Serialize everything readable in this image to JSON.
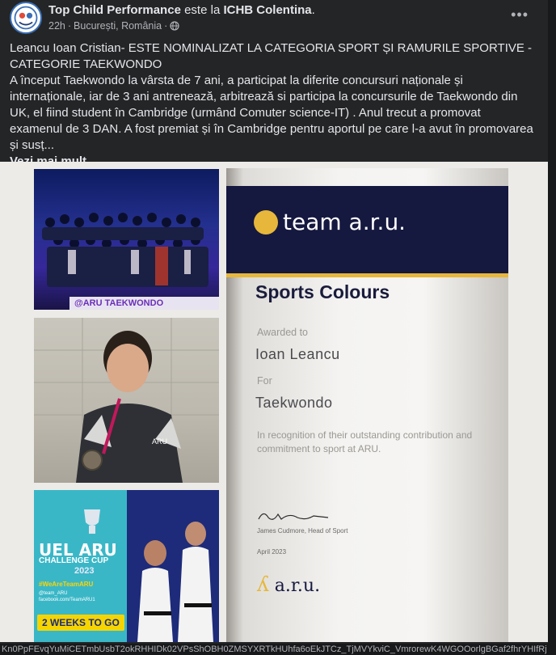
{
  "header": {
    "page_name": "Top Child Performance",
    "connector": " este la ",
    "place": "ICHB Colentina",
    "dot": ".",
    "time": "22h",
    "location": "București, România"
  },
  "post": {
    "paragraph1": "Leancu Ioan Cristian- ESTE NOMINALIZAT LA CATEGORIA SPORT ȘI RAMURILE SPORTIVE - CATEGORIE TAEKWONDO",
    "paragraph2": " A început Taekwondo la vârsta de 7 ani, a participat la diferite concursuri naționale și internaționale, iar de 3 ani antrenează, arbitrează si participa la concursurile de Taekwondo din UK, el fiind student în Cambridge (urmând Comuter science-IT) . Anul trecut a promovat examenul de 3 DAN. A fost premiat și în Cambridge pentru aportul pe care l-a avut în promovarea și susț...",
    "see_more": "Vezi mai mult"
  },
  "photos": {
    "crowd_handle": "@ARU TAEKWONDO",
    "uel_logo": "UEL ARU",
    "challenge_cup": "CHALLENGE CUP",
    "year": "2023",
    "hashtag": "#WeAreTeamARU",
    "social_1": "@team_ARU",
    "social_2": "facebook.com/TeamARU1",
    "countdown": "2 WEEKS TO GO"
  },
  "certificate": {
    "brand": "team a.r.u.",
    "title": "Sports Colours",
    "awarded_label": "Awarded to",
    "awarded_name": "Ioan Leancu",
    "for_label": "For",
    "for_value": "Taekwondo",
    "recognition": "In recognition of their outstanding contribution and commitment to sport at ARU.",
    "signer": "James Cudmore, Head of Sport",
    "date": "April 2023",
    "footer_logo": "a.r.u."
  },
  "urlbar": "Kn0PpFEvqYuMiCETmbUsbT2okRHHIDk02VPsShOBH0ZMSYXRTkHUhfa6oEkJTCz_TjMVYkviC_VmrorewK4WGOOorlgBGaf2fhrYHIfRj",
  "icons": {
    "globe": "globe-icon",
    "more": "more-options-icon"
  },
  "colors": {
    "post_bg": "#242526",
    "page_bg": "#18191a",
    "text": "#e4e6eb",
    "muted": "#b0b3b8",
    "navy": "#15183f",
    "gold": "#e6b73a"
  }
}
